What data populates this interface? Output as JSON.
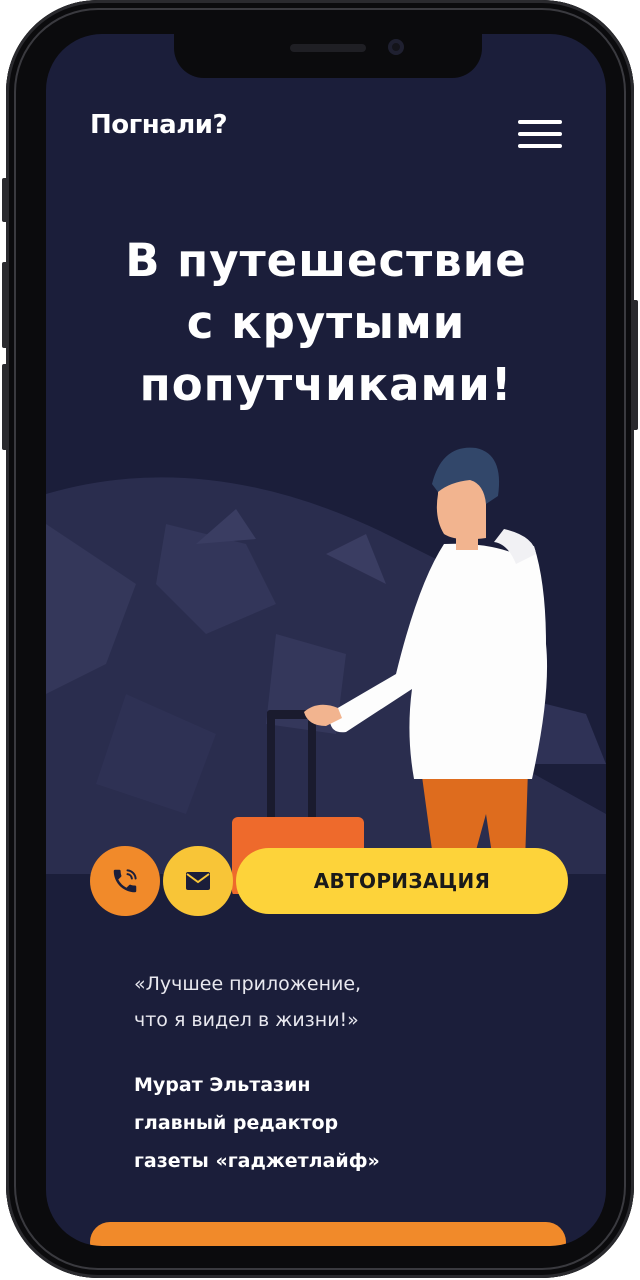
{
  "header": {
    "logo": "Погнали?",
    "menu_icon": "hamburger-menu-icon"
  },
  "hero": {
    "title_line1": "В путешествие",
    "title_line2": "с крутыми",
    "title_line3": "попутчиками!"
  },
  "actions": {
    "phone_icon": "phone-icon",
    "mail_icon": "mail-icon",
    "auth_label": "АВТОРИЗАЦИЯ"
  },
  "testimonial": {
    "quote_line1": "«Лучшее приложение,",
    "quote_line2": "что я видел в жизни!»",
    "author_name": "Мурат Эльтазин",
    "author_role": "главный редактор",
    "author_org": "газеты «гаджетлайф»"
  },
  "colors": {
    "background": "#1b1e3a",
    "accent_orange": "#f18a2a",
    "accent_yellow": "#fdd33a",
    "text": "#ffffff"
  }
}
